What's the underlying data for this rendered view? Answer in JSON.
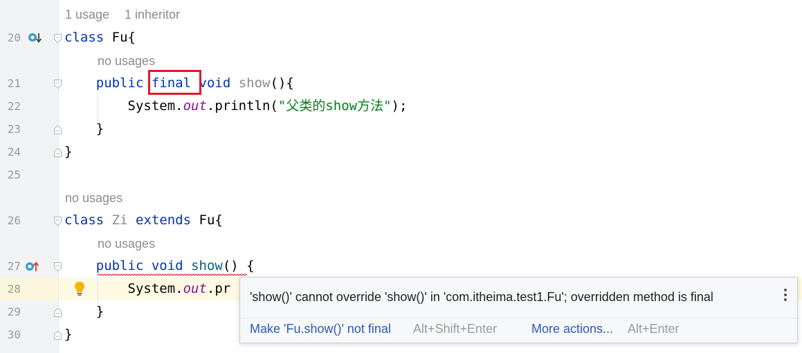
{
  "editor": {
    "line_numbers": [
      "20",
      "21",
      "22",
      "23",
      "24",
      "25",
      "26",
      "27",
      "28",
      "29",
      "30"
    ],
    "hints": {
      "fu_usage": "1 usage",
      "fu_inheritor": "1 inheritor",
      "show_usages": "no usages",
      "zi_usages": "no usages",
      "zi_show_usages": "no usages"
    },
    "tokens": {
      "class_kw": "class",
      "fu_name": "Fu",
      "brace_open": "{",
      "brace_close": "}",
      "public_kw": "public",
      "final_kw": "final",
      "void_kw": "void",
      "show_name": "show",
      "parens_brace": "(){",
      "system": "System.",
      "out": "out",
      "println": ".println(",
      "string_lit": "\"父类的show方法\"",
      "close_stmt": ");",
      "zi_name": "Zi",
      "extends_kw": "extends",
      "zi_show_parens": "() {",
      "pr": ".pr"
    }
  },
  "popup": {
    "message": "'show()' cannot override 'show()' in 'com.itheima.test1.Fu'; overridden method is final",
    "action1": "Make 'Fu.show()' not final",
    "shortcut1": "Alt+Shift+Enter",
    "action2": "More actions...",
    "shortcut2": "Alt+Enter"
  },
  "colors": {
    "keyword": "#0033b3",
    "string": "#067d17",
    "field": "#871094",
    "highlight_box": "#e0192a",
    "link": "#2a5ab5"
  },
  "icons": [
    "implemented-icon",
    "overrides-icon",
    "fold-icon",
    "lightbulb-icon",
    "more-vertical-icon"
  ]
}
